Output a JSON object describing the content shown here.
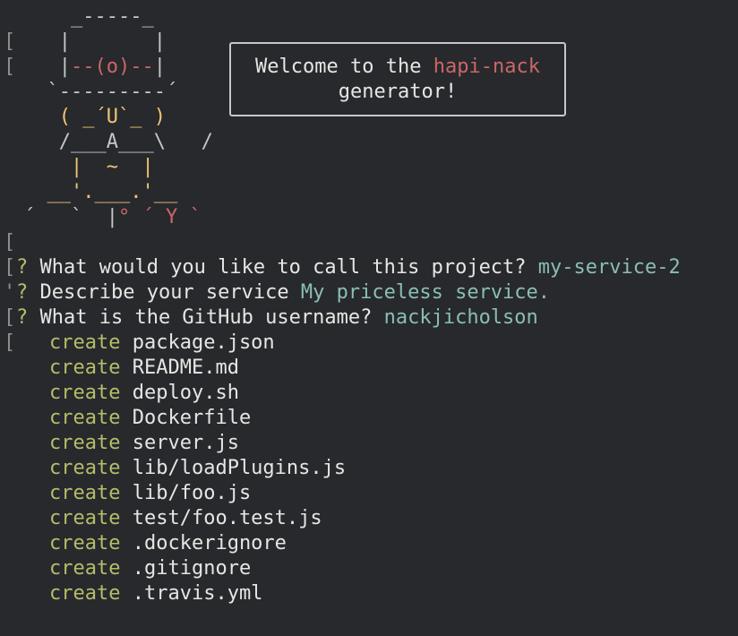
{
  "art": {
    "row1": "    _-----_",
    "row2": "   |       |",
    "row3a": "   |",
    "row3b": "--(o)--",
    "row3c": "|",
    "row4": "  `---------´",
    "row5": "   ( _´U`_ )",
    "row6": "   /___A___\\   /",
    "row7": "    |  ~  |",
    "row8": "  __'.___.'__",
    "row9a": "´   `  |",
    "row9b": "° ´ Y `"
  },
  "welcome": {
    "prefix": "Welcome to the ",
    "name": "hapi-nack",
    "line2": "generator!"
  },
  "prompts": [
    {
      "mark": "?",
      "question": " What would you like to call this project? ",
      "answer": "my-service-2"
    },
    {
      "mark": "?",
      "question": " Describe your service ",
      "answer": "My priceless service."
    },
    {
      "mark": "?",
      "question": " What is the GitHub username? ",
      "answer": "nackjicholson"
    }
  ],
  "create_word": "create",
  "files": [
    "package.json",
    "README.md",
    "deploy.sh",
    "Dockerfile",
    "server.js",
    "lib/loadPlugins.js",
    "lib/foo.js",
    "test/foo.test.js",
    ".dockerignore",
    ".gitignore",
    ".travis.yml"
  ],
  "colors": {
    "background": "#27292d",
    "text": "#d6d6d3",
    "yellow": "#f0c674",
    "red": "#cc6666",
    "cyan": "#8abeb7",
    "green": "#b5bd68"
  }
}
